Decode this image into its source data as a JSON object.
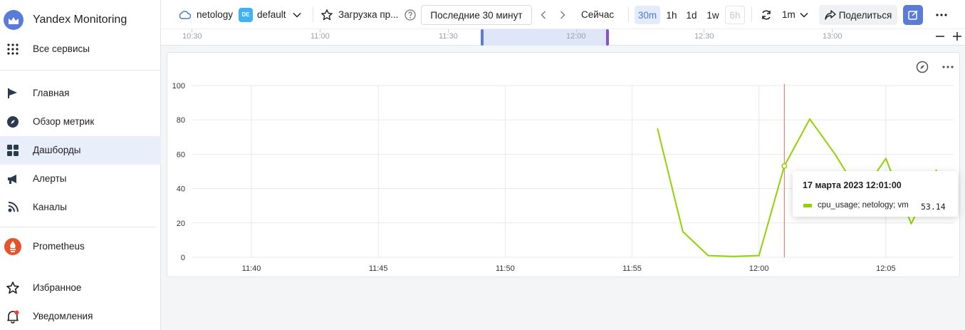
{
  "sidebar": {
    "brand": "Yandex Monitoring",
    "all_services": "Все сервисы",
    "items": [
      {
        "label": "Главная",
        "icon": "flag-icon"
      },
      {
        "label": "Обзор метрик",
        "icon": "compass-icon"
      },
      {
        "label": "Дашборды",
        "icon": "dashboard-grid-icon",
        "active": true
      },
      {
        "label": "Алерты",
        "icon": "megaphone-icon"
      },
      {
        "label": "Каналы",
        "icon": "broadcast-icon"
      }
    ],
    "prometheus": "Prometheus",
    "favorites": "Избранное",
    "notifications": "Уведомления"
  },
  "toolbar": {
    "cloud": "netology",
    "folder_badge": "DE",
    "folder": "default",
    "dashboard_title": "Загрузка пр...",
    "time_range": "Последние 30 минут",
    "now": "Сейчас",
    "presets": [
      "30m",
      "1h",
      "1d",
      "1w",
      "6h"
    ],
    "selected_preset": "30m",
    "refresh_interval": "1m",
    "share": "Поделиться"
  },
  "timeline": {
    "labels": [
      "10:30",
      "11:00",
      "11:30",
      "12:00",
      "12:30",
      "13:00"
    ]
  },
  "colors": {
    "accent": "#5a7bd8",
    "series": "#8fd400",
    "crosshair": "#e8433b"
  },
  "chart_data": {
    "type": "line",
    "y_ticks": [
      "0",
      "20",
      "40",
      "60",
      "80",
      "100"
    ],
    "x_ticks": [
      "11:40",
      "11:45",
      "11:50",
      "11:55",
      "12:00",
      "12:05"
    ],
    "ylim": [
      0,
      100
    ],
    "grid": true,
    "series": [
      {
        "name": "cpu_usage; netology; vm",
        "points": [
          {
            "t": "11:56",
            "v": 75
          },
          {
            "t": "11:57",
            "v": 15
          },
          {
            "t": "11:58",
            "v": 1
          },
          {
            "t": "11:59",
            "v": 0.5
          },
          {
            "t": "12:00",
            "v": 1
          },
          {
            "t": "12:01",
            "v": 53.14
          },
          {
            "t": "12:02",
            "v": 80.5
          },
          {
            "t": "12:03",
            "v": 60
          },
          {
            "t": "12:04",
            "v": 36
          },
          {
            "t": "12:05",
            "v": 57.5
          },
          {
            "t": "12:06",
            "v": 19.5
          },
          {
            "t": "12:07",
            "v": 51
          }
        ]
      }
    ],
    "cursor_time": "12:01"
  },
  "tooltip": {
    "title": "17 марта 2023 12:01:00",
    "series": "cpu_usage; netology; vm",
    "value": "53.14"
  }
}
